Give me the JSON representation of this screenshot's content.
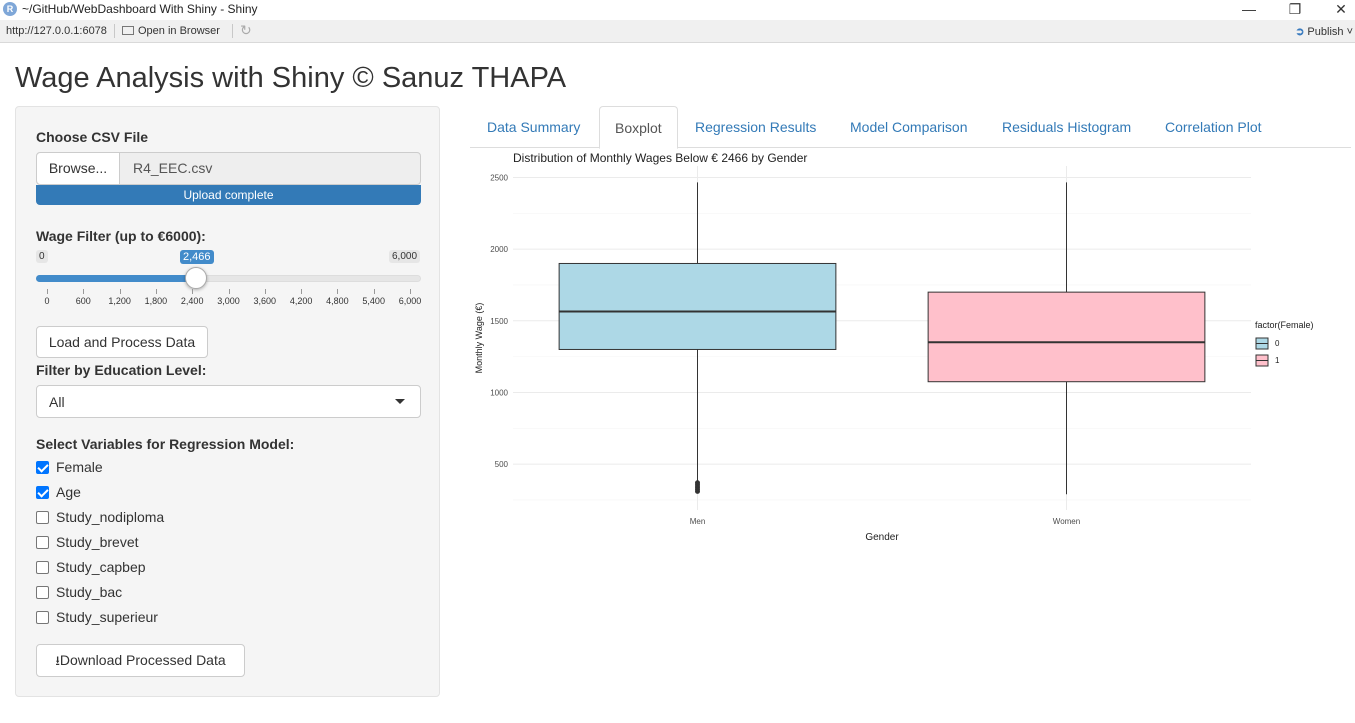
{
  "window": {
    "title": "~/GitHub/WebDashboard With Shiny - Shiny",
    "app_icon": "R",
    "minimize": "—",
    "maximize": "❐",
    "close": "✕"
  },
  "toolbar": {
    "url": "http://127.0.0.1:6078",
    "open_browser": "Open in Browser",
    "publish": "Publish"
  },
  "page_title": "Wage Analysis with Shiny © Sanuz THAPA",
  "sidebar": {
    "file_label": "Choose CSV File",
    "browse_label": "Browse...",
    "file_name": "R4_EEC.csv",
    "upload_status": "Upload complete",
    "upload_progress": 1.0,
    "slider_label": "Wage Filter (up to €6000):",
    "slider_min": "0",
    "slider_max": "6,000",
    "slider_value_label": "2,466",
    "slider_value": 2466,
    "slider_ticks": [
      "0",
      "600",
      "1,200",
      "1,800",
      "2,400",
      "3,000",
      "3,600",
      "4,200",
      "4,800",
      "5,400",
      "6,000"
    ],
    "load_button": "Load and Process Data",
    "education_label": "Filter by Education Level:",
    "education_selected": "All",
    "vars_label": "Select Variables for Regression Model:",
    "variables": [
      {
        "label": "Female",
        "checked": true
      },
      {
        "label": "Age",
        "checked": true
      },
      {
        "label": "Study_nodiploma",
        "checked": false
      },
      {
        "label": "Study_brevet",
        "checked": false
      },
      {
        "label": "Study_capbep",
        "checked": false
      },
      {
        "label": "Study_bac",
        "checked": false
      },
      {
        "label": "Study_superieur",
        "checked": false
      }
    ],
    "download_button": "Download Processed Data",
    "download_icon": "download-icon"
  },
  "tabs": [
    {
      "label": "Data Summary",
      "active": false
    },
    {
      "label": "Boxplot",
      "active": true
    },
    {
      "label": "Regression Results",
      "active": false
    },
    {
      "label": "Model Comparison",
      "active": false
    },
    {
      "label": "Residuals Histogram",
      "active": false
    },
    {
      "label": "Correlation Plot",
      "active": false
    }
  ],
  "chart_data": {
    "type": "boxplot",
    "title": "Distribution of Monthly Wages Below € 2466  by Gender",
    "xlabel": "Gender",
    "ylabel": "Monthly Wage (€)",
    "ylim": [
      180,
      2580
    ],
    "yticks": [
      500,
      1000,
      1500,
      2000,
      2500
    ],
    "categories": [
      "Men",
      "Women"
    ],
    "boxes": [
      {
        "category": "Men",
        "group": "0",
        "min": 300,
        "q1": 1300,
        "median": 1565,
        "q3": 1900,
        "max": 2466,
        "outliers": [
          310,
          325,
          340,
          355,
          370
        ],
        "color": "#add8e6"
      },
      {
        "category": "Women",
        "group": "1",
        "min": 290,
        "q1": 1075,
        "median": 1350,
        "q3": 1700,
        "max": 2466,
        "outliers": [],
        "color": "#ffc0cb"
      }
    ],
    "legend": {
      "title": "factor(Female)",
      "entries": [
        "0",
        "1"
      ],
      "position": "right"
    },
    "grid": true
  }
}
